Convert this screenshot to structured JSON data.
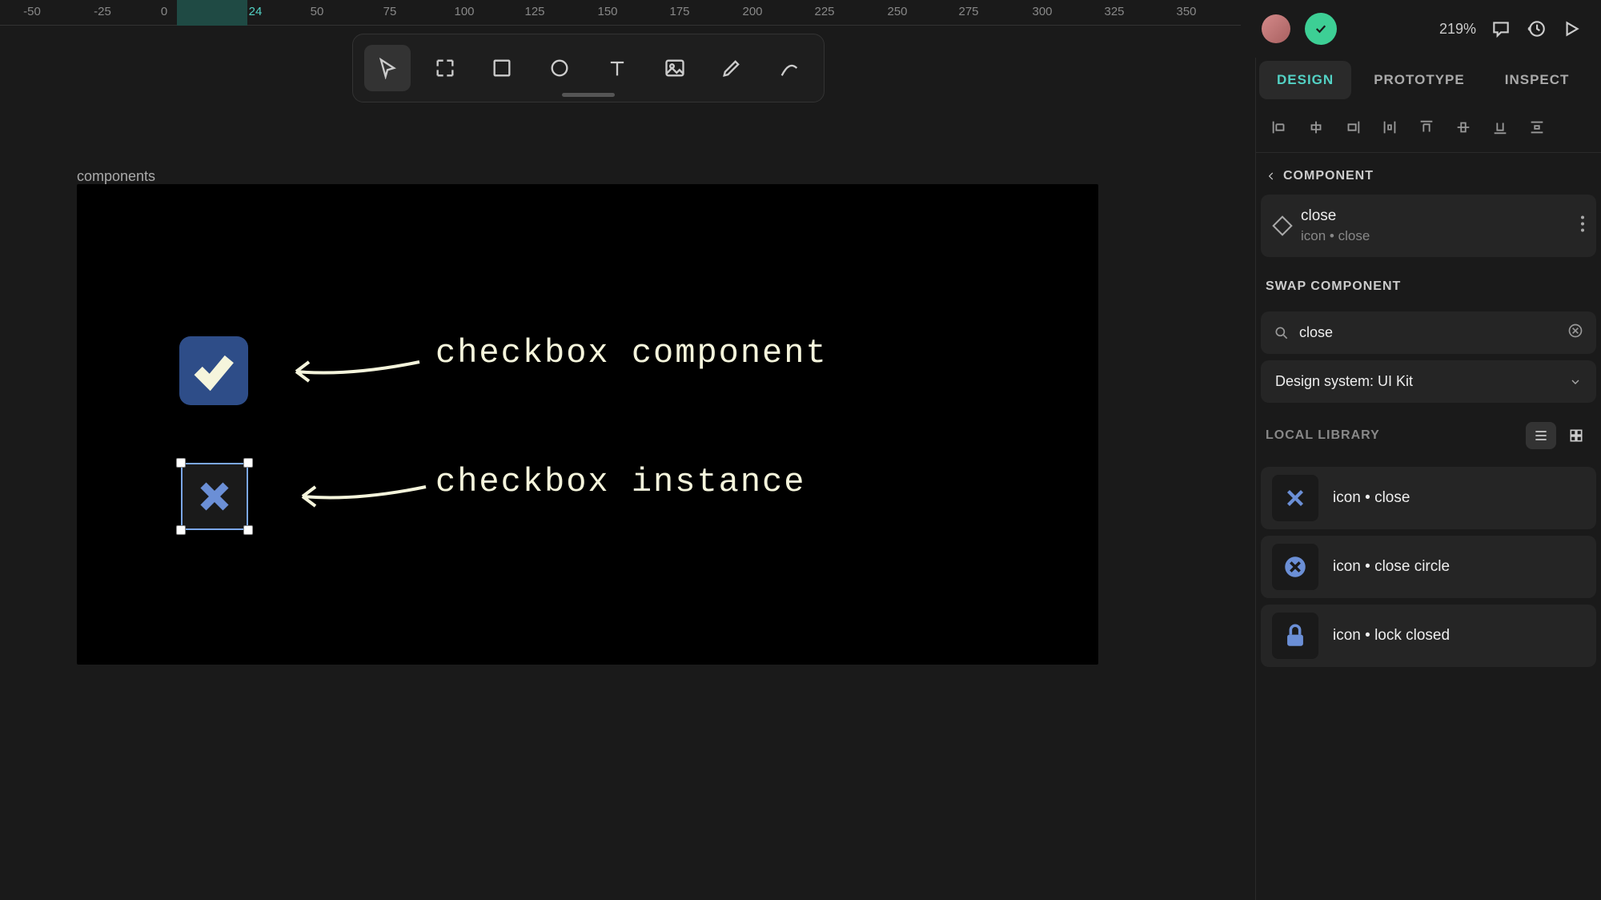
{
  "ruler": {
    "ticks": [
      "-50",
      "-25",
      "0",
      "24",
      "50",
      "75",
      "100",
      "125",
      "150",
      "175",
      "200",
      "225",
      "250",
      "275",
      "300",
      "325",
      "350"
    ],
    "active": "24",
    "highlight_start": 221,
    "highlight_end": 309
  },
  "zoom": "219%",
  "tabs": {
    "design": "DESIGN",
    "prototype": "PROTOTYPE",
    "inspect": "INSPECT"
  },
  "canvas": {
    "frame_label": "components",
    "annot1": "checkbox component",
    "annot2": "checkbox instance"
  },
  "component_section": {
    "header": "COMPONENT",
    "name": "close",
    "breadcrumb": "icon • close"
  },
  "swap": {
    "header": "SWAP COMPONENT",
    "search_value": "close",
    "library": "Design system: UI Kit",
    "local_label": "LOCAL LIBRARY",
    "results": [
      {
        "label": "icon • close",
        "icon": "x"
      },
      {
        "label": "icon • close circle",
        "icon": "x-circle"
      },
      {
        "label": "icon • lock closed",
        "icon": "lock"
      }
    ]
  }
}
